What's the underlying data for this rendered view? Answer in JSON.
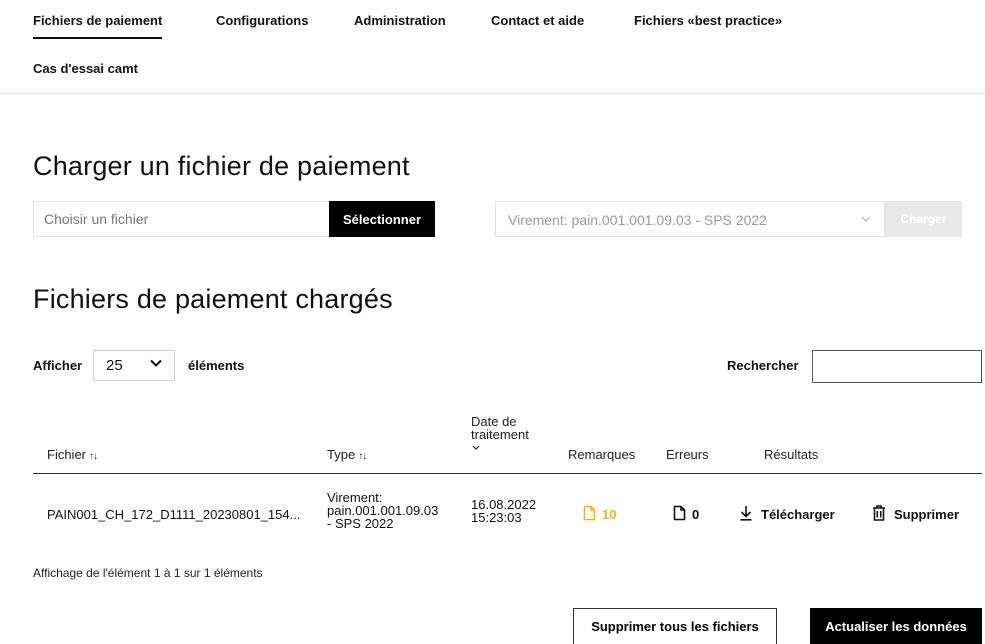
{
  "nav": {
    "items": [
      {
        "label": "Fichiers de paiement"
      },
      {
        "label": "Configurations"
      },
      {
        "label": "Administration"
      },
      {
        "label": "Contact et aide"
      },
      {
        "label": "Fichiers «best practice»"
      },
      {
        "label": "Cas d'essai camt"
      }
    ],
    "active_index": 0
  },
  "upload": {
    "title": "Charger un fichier de paiement",
    "file_placeholder": "Choisir un fichier",
    "select_button": "Sélectionner",
    "type_selected": "Virement: pain.001.001.09.03 - SPS 2022",
    "load_button": "Charger"
  },
  "files": {
    "title": "Fichiers de paiement chargés",
    "show_label": "Afficher",
    "page_length": "25",
    "elements_label": "éléments",
    "search_label": "Rechercher",
    "columns": {
      "file": "Fichier",
      "type": "Type",
      "date_line1": "Date de",
      "date_line2": "traitement",
      "remarks": "Remarques",
      "errors": "Erreurs",
      "results": "Résultats"
    },
    "rows": [
      {
        "file": "PAIN001_CH_172_D1111_20230801_154...",
        "type_line1": "Virement:",
        "type_line2": "pain.001.001.09.03",
        "type_line3": "- SPS 2022",
        "date_line1": "16.08.2022",
        "date_line2": "15:23:03",
        "remarks": "10",
        "errors": "0",
        "download": "Télécharger",
        "delete": "Supprimer"
      }
    ],
    "info": "Affichage de l'élément 1 à 1 sur 1 éléments",
    "delete_all_button": "Supprimer tous les fichiers",
    "refresh_button": "Actualiser les données"
  },
  "colors": {
    "accent": "#000000",
    "remarks": "#f5b21b",
    "border": "#e3e3e3"
  },
  "icons": {
    "sort": "sort-arrows-icon",
    "chevron": "chevron-down-icon",
    "document": "document-icon",
    "download": "download-icon",
    "trash": "trash-icon"
  }
}
